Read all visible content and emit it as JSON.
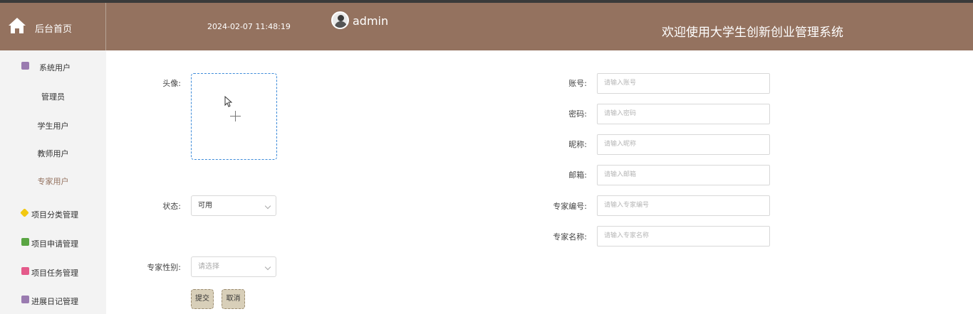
{
  "header": {
    "home_label": "后台首页",
    "datetime": "2024-02-07 11:48:19",
    "username": "admin",
    "system_title": "欢迎使用大学生创新创业管理系统",
    "colors": {
      "header_bg": "#94725f",
      "accent": "#94725f"
    }
  },
  "sidebar": {
    "group_system_users": {
      "label": "系统用户",
      "icon": "user-group-icon"
    },
    "sub_items": [
      {
        "label": "管理员"
      },
      {
        "label": "学生用户"
      },
      {
        "label": "教师用户"
      },
      {
        "label": "专家用户",
        "active": true
      }
    ],
    "menus": [
      {
        "label": "项目分类管理",
        "icon": "category-icon"
      },
      {
        "label": "项目申请管理",
        "icon": "message-icon"
      },
      {
        "label": "项目任务管理",
        "icon": "task-icon"
      },
      {
        "label": "进展日记管理",
        "icon": "diary-icon"
      }
    ]
  },
  "form": {
    "avatar_label": "头像:",
    "status_label": "状态:",
    "status_value": "可用",
    "gender_label": "专家性别:",
    "gender_placeholder": "请选择",
    "account_label": "账号:",
    "account_placeholder": "请输入账号",
    "password_label": "密码:",
    "password_placeholder": "请输入密码",
    "nickname_label": "昵称:",
    "nickname_placeholder": "请输入昵称",
    "email_label": "邮箱:",
    "email_placeholder": "请输入邮箱",
    "expert_no_label": "专家编号:",
    "expert_no_placeholder": "请输入专家编号",
    "expert_name_label": "专家名称:",
    "expert_name_placeholder": "请输入专家名称",
    "submit_label": "提交",
    "cancel_label": "取消"
  }
}
